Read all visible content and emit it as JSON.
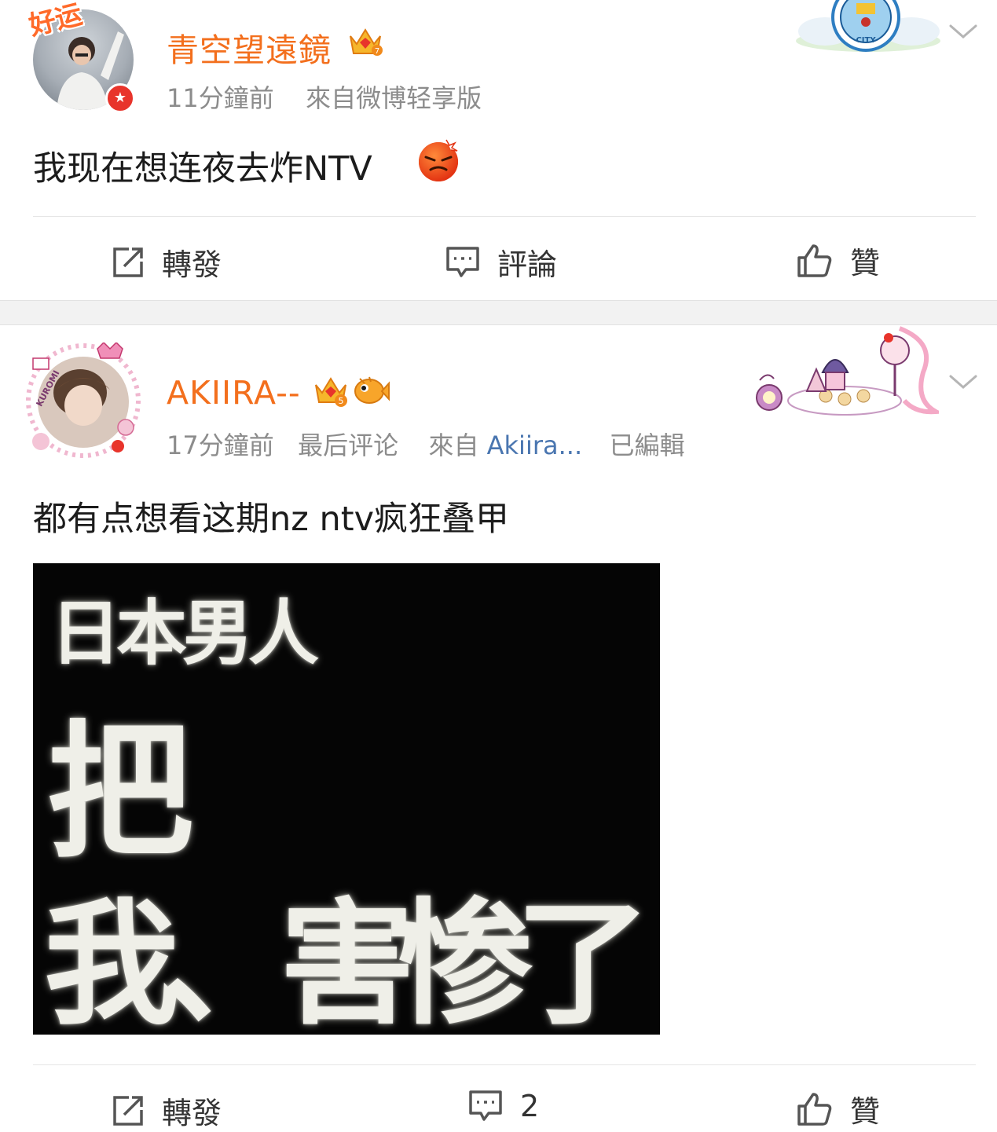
{
  "posts": [
    {
      "username": "青空望遠鏡",
      "time": "11分鐘前",
      "source": "來自微博轻享版",
      "avatar_badge": "好运",
      "text": "我现在想连夜去炸NTV",
      "emoji": "angry-face",
      "decoration": "CITY",
      "actions": {
        "repost": "轉發",
        "comment": "評論",
        "like": "贊"
      }
    },
    {
      "username": "AKIIRA--",
      "time": "17分鐘前",
      "last_comment": "最后评论",
      "source_prefix": "來自",
      "source_link": "Akiira...",
      "edited": "已編輯",
      "avatar_text": "KUROMI",
      "text": "都有点想看这期nz ntv疯狂叠甲",
      "image_lines": [
        "日本男人",
        "把",
        "我、害惨了"
      ],
      "actions": {
        "repost": "轉發",
        "comment": "2",
        "like": "贊"
      }
    }
  ],
  "colors": {
    "username": "#f36f1d",
    "meta": "#8c8c8c",
    "link": "#4a76b0",
    "separator": "#f2f2f2"
  }
}
